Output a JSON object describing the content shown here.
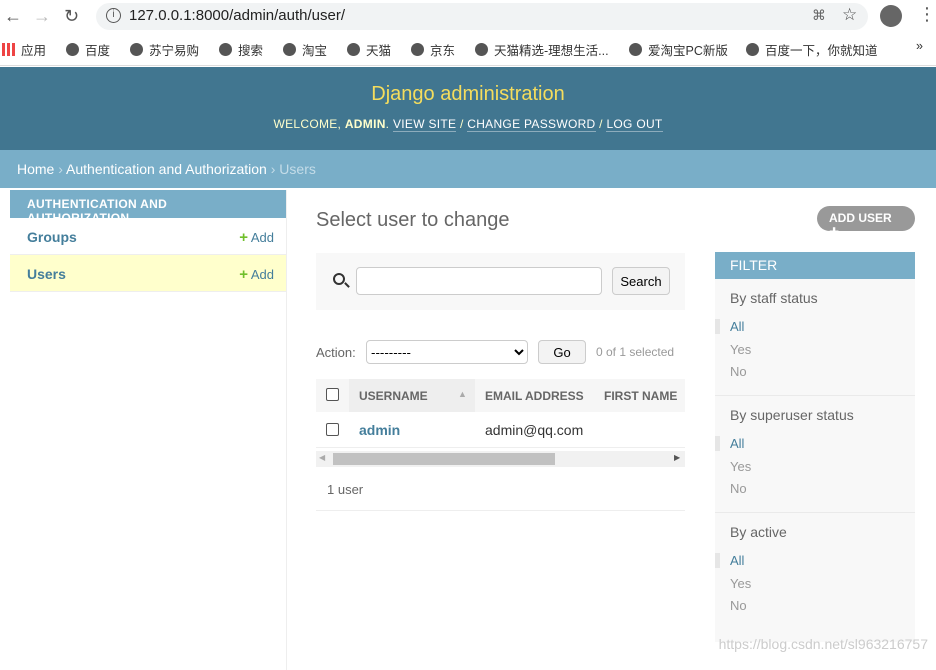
{
  "browser": {
    "url": "127.0.0.1:8000/admin/auth/user/",
    "bookmarks": [
      "应用",
      "百度",
      "苏宁易购",
      "搜索",
      "淘宝",
      "天猫",
      "京东",
      "天猫精选-理想生活...",
      "爱淘宝PC新版",
      "百度一下，你就知道"
    ],
    "more": "»"
  },
  "header": {
    "branding": "Django administration",
    "welcome": "WELCOME,",
    "user": "ADMIN",
    "view_site": "VIEW SITE",
    "change_password": "CHANGE PASSWORD",
    "logout": "LOG OUT"
  },
  "breadcrumbs": {
    "home": "Home",
    "app": "Authentication and Authorization",
    "current": "Users"
  },
  "sidebar": {
    "caption": "AUTHENTICATION AND AUTHORIZATION",
    "items": [
      {
        "label": "Groups",
        "add": "Add"
      },
      {
        "label": "Users",
        "add": "Add"
      }
    ]
  },
  "main": {
    "title": "Select user to change",
    "add_user": "ADD USER",
    "search_button": "Search",
    "search_value": "",
    "action_label": "Action:",
    "action_selected": "---------",
    "go": "Go",
    "selected": "0 of 1 selected",
    "columns": [
      "USERNAME",
      "EMAIL ADDRESS",
      "FIRST NAME"
    ],
    "rows": [
      {
        "username": "admin",
        "email": "admin@qq.com",
        "first_name": ""
      }
    ],
    "count": "1 user"
  },
  "filter": {
    "title": "FILTER",
    "groups": [
      {
        "title": "By staff status",
        "options": [
          "All",
          "Yes",
          "No"
        ]
      },
      {
        "title": "By superuser status",
        "options": [
          "All",
          "Yes",
          "No"
        ]
      },
      {
        "title": "By active",
        "options": [
          "All",
          "Yes",
          "No"
        ]
      }
    ]
  },
  "watermark": "https://blog.csdn.net/sl963216757",
  "colors": {
    "header": "#417690",
    "breadcrumb": "#79aec8",
    "branding": "#f5dd5d",
    "link": "#447e9b",
    "selected_row": "#ffffcc",
    "add": "#70bf2b"
  }
}
